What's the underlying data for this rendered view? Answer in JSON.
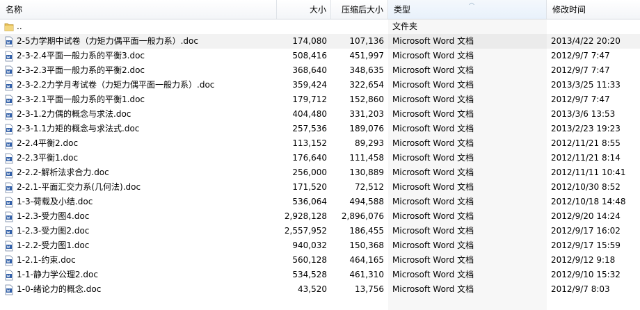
{
  "columns": {
    "name": "名称",
    "size": "大小",
    "compressed": "压缩后大小",
    "type": "类型",
    "modified": "修改时间"
  },
  "parent_row": {
    "name": "..",
    "type": "文件夹"
  },
  "files": [
    {
      "name": "2-5力学期中试卷（力矩力偶平面一般力系）.doc",
      "size": "174,080",
      "compressed": "107,136",
      "type": "Microsoft Word 文档",
      "modified": "2013/4/22 20:20"
    },
    {
      "name": "2-3-2.4平面一般力系的平衡3.doc",
      "size": "508,416",
      "compressed": "451,997",
      "type": "Microsoft Word 文档",
      "modified": "2012/9/7 7:47"
    },
    {
      "name": "2-3-2.3平面一般力系的平衡2.doc",
      "size": "368,640",
      "compressed": "348,635",
      "type": "Microsoft Word 文档",
      "modified": "2012/9/7 7:47"
    },
    {
      "name": "2-3-2.2力学月考试卷（力矩力偶平面一般力系）.doc",
      "size": "359,424",
      "compressed": "322,654",
      "type": "Microsoft Word 文档",
      "modified": "2013/3/25 11:33"
    },
    {
      "name": "2-3-2.1平面一般力系的平衡1.doc",
      "size": "179,712",
      "compressed": "152,860",
      "type": "Microsoft Word 文档",
      "modified": "2012/9/7 7:47"
    },
    {
      "name": "2-3-1.2力偶的概念与求法.doc",
      "size": "404,480",
      "compressed": "331,203",
      "type": "Microsoft Word 文档",
      "modified": "2013/3/6 13:53"
    },
    {
      "name": "2-3-1.1力矩的概念与求法式.doc",
      "size": "257,536",
      "compressed": "189,076",
      "type": "Microsoft Word 文档",
      "modified": "2013/2/23 19:23"
    },
    {
      "name": "2-2.4平衡2.doc",
      "size": "113,152",
      "compressed": "89,293",
      "type": "Microsoft Word 文档",
      "modified": "2012/11/21 8:55"
    },
    {
      "name": "2-2.3平衡1.doc",
      "size": "176,640",
      "compressed": "111,458",
      "type": "Microsoft Word 文档",
      "modified": "2012/11/21 8:14"
    },
    {
      "name": "2-2.2-解析法求合力.doc",
      "size": "256,000",
      "compressed": "130,889",
      "type": "Microsoft Word 文档",
      "modified": "2012/11/11 10:41"
    },
    {
      "name": "2-2.1-平面汇交力系(几何法).doc",
      "size": "171,520",
      "compressed": "72,512",
      "type": "Microsoft Word 文档",
      "modified": "2012/10/30 8:52"
    },
    {
      "name": "1-3-荷载及小结.doc",
      "size": "536,064",
      "compressed": "494,588",
      "type": "Microsoft Word 文档",
      "modified": "2012/10/18 14:48"
    },
    {
      "name": "1-2.3-受力图4.doc",
      "size": "2,928,128",
      "compressed": "2,896,076",
      "type": "Microsoft Word 文档",
      "modified": "2012/9/20 14:24"
    },
    {
      "name": "1-2.3-受力图2.doc",
      "size": "2,557,952",
      "compressed": "186,455",
      "type": "Microsoft Word 文档",
      "modified": "2012/9/17 16:02"
    },
    {
      "name": "1-2.2-受力图1.doc",
      "size": "940,032",
      "compressed": "150,368",
      "type": "Microsoft Word 文档",
      "modified": "2012/9/17 15:59"
    },
    {
      "name": "1-2.1-约束.doc",
      "size": "560,128",
      "compressed": "464,165",
      "type": "Microsoft Word 文档",
      "modified": "2012/9/12 9:18"
    },
    {
      "name": "1-1-静力学公理2.doc",
      "size": "534,528",
      "compressed": "461,310",
      "type": "Microsoft Word 文档",
      "modified": "2012/9/10 15:32"
    },
    {
      "name": "1-0-绪论力的概念.doc",
      "size": "43,520",
      "compressed": "13,756",
      "type": "Microsoft Word 文档",
      "modified": "2012/9/7 8:03"
    }
  ],
  "icons": {
    "folder": "folder-icon",
    "doc": "word-doc-icon"
  },
  "colors": {
    "folder": "#e8c15a",
    "doc_icon": "#2f5ea8",
    "row_highlight": "#f2f2f2"
  }
}
